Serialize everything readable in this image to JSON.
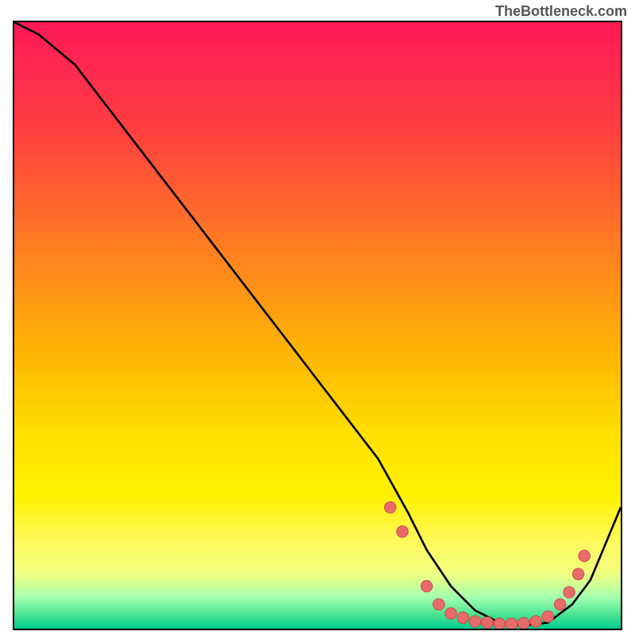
{
  "watermark": "TheBottleneck.com",
  "chart_data": {
    "type": "line",
    "title": "",
    "xlabel": "",
    "ylabel": "",
    "xlim": [
      0,
      100
    ],
    "ylim": [
      0,
      100
    ],
    "series": [
      {
        "name": "curve",
        "x": [
          0,
          4,
          10,
          20,
          30,
          40,
          50,
          60,
          65,
          68,
          72,
          76,
          80,
          84,
          88,
          92,
          95,
          100
        ],
        "values": [
          100,
          98,
          93,
          80,
          67,
          54,
          41,
          28,
          19,
          13,
          7,
          3,
          1,
          0.5,
          1,
          4,
          8,
          20
        ]
      }
    ],
    "dots": [
      {
        "x": 62,
        "y": 20
      },
      {
        "x": 64,
        "y": 16
      },
      {
        "x": 68,
        "y": 7
      },
      {
        "x": 70,
        "y": 4
      },
      {
        "x": 72,
        "y": 2.5
      },
      {
        "x": 74,
        "y": 1.8
      },
      {
        "x": 76,
        "y": 1.2
      },
      {
        "x": 78,
        "y": 1
      },
      {
        "x": 80,
        "y": 0.8
      },
      {
        "x": 82,
        "y": 0.8
      },
      {
        "x": 84,
        "y": 0.9
      },
      {
        "x": 86,
        "y": 1.2
      },
      {
        "x": 88,
        "y": 2
      },
      {
        "x": 90,
        "y": 4
      },
      {
        "x": 91.5,
        "y": 6
      },
      {
        "x": 93,
        "y": 9
      },
      {
        "x": 94,
        "y": 12
      }
    ],
    "colors": {
      "curve_stroke": "#000000",
      "dot_fill": "#e86a6a",
      "dot_stroke": "#d04848"
    }
  }
}
